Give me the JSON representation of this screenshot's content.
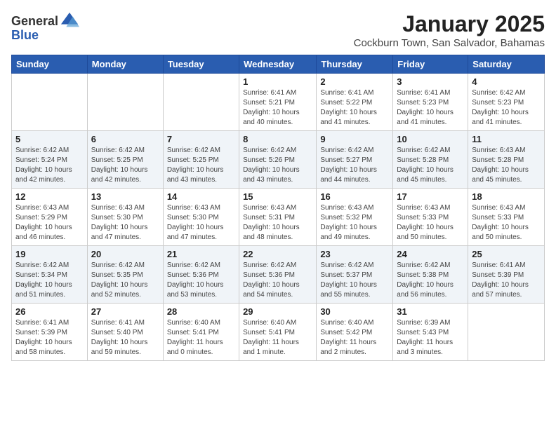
{
  "logo": {
    "general": "General",
    "blue": "Blue"
  },
  "title": "January 2025",
  "subtitle": "Cockburn Town, San Salvador, Bahamas",
  "days_of_week": [
    "Sunday",
    "Monday",
    "Tuesday",
    "Wednesday",
    "Thursday",
    "Friday",
    "Saturday"
  ],
  "weeks": [
    [
      {
        "day": "",
        "info": ""
      },
      {
        "day": "",
        "info": ""
      },
      {
        "day": "",
        "info": ""
      },
      {
        "day": "1",
        "info": "Sunrise: 6:41 AM\nSunset: 5:21 PM\nDaylight: 10 hours\nand 40 minutes."
      },
      {
        "day": "2",
        "info": "Sunrise: 6:41 AM\nSunset: 5:22 PM\nDaylight: 10 hours\nand 41 minutes."
      },
      {
        "day": "3",
        "info": "Sunrise: 6:41 AM\nSunset: 5:23 PM\nDaylight: 10 hours\nand 41 minutes."
      },
      {
        "day": "4",
        "info": "Sunrise: 6:42 AM\nSunset: 5:23 PM\nDaylight: 10 hours\nand 41 minutes."
      }
    ],
    [
      {
        "day": "5",
        "info": "Sunrise: 6:42 AM\nSunset: 5:24 PM\nDaylight: 10 hours\nand 42 minutes."
      },
      {
        "day": "6",
        "info": "Sunrise: 6:42 AM\nSunset: 5:25 PM\nDaylight: 10 hours\nand 42 minutes."
      },
      {
        "day": "7",
        "info": "Sunrise: 6:42 AM\nSunset: 5:25 PM\nDaylight: 10 hours\nand 43 minutes."
      },
      {
        "day": "8",
        "info": "Sunrise: 6:42 AM\nSunset: 5:26 PM\nDaylight: 10 hours\nand 43 minutes."
      },
      {
        "day": "9",
        "info": "Sunrise: 6:42 AM\nSunset: 5:27 PM\nDaylight: 10 hours\nand 44 minutes."
      },
      {
        "day": "10",
        "info": "Sunrise: 6:42 AM\nSunset: 5:28 PM\nDaylight: 10 hours\nand 45 minutes."
      },
      {
        "day": "11",
        "info": "Sunrise: 6:43 AM\nSunset: 5:28 PM\nDaylight: 10 hours\nand 45 minutes."
      }
    ],
    [
      {
        "day": "12",
        "info": "Sunrise: 6:43 AM\nSunset: 5:29 PM\nDaylight: 10 hours\nand 46 minutes."
      },
      {
        "day": "13",
        "info": "Sunrise: 6:43 AM\nSunset: 5:30 PM\nDaylight: 10 hours\nand 47 minutes."
      },
      {
        "day": "14",
        "info": "Sunrise: 6:43 AM\nSunset: 5:30 PM\nDaylight: 10 hours\nand 47 minutes."
      },
      {
        "day": "15",
        "info": "Sunrise: 6:43 AM\nSunset: 5:31 PM\nDaylight: 10 hours\nand 48 minutes."
      },
      {
        "day": "16",
        "info": "Sunrise: 6:43 AM\nSunset: 5:32 PM\nDaylight: 10 hours\nand 49 minutes."
      },
      {
        "day": "17",
        "info": "Sunrise: 6:43 AM\nSunset: 5:33 PM\nDaylight: 10 hours\nand 50 minutes."
      },
      {
        "day": "18",
        "info": "Sunrise: 6:43 AM\nSunset: 5:33 PM\nDaylight: 10 hours\nand 50 minutes."
      }
    ],
    [
      {
        "day": "19",
        "info": "Sunrise: 6:42 AM\nSunset: 5:34 PM\nDaylight: 10 hours\nand 51 minutes."
      },
      {
        "day": "20",
        "info": "Sunrise: 6:42 AM\nSunset: 5:35 PM\nDaylight: 10 hours\nand 52 minutes."
      },
      {
        "day": "21",
        "info": "Sunrise: 6:42 AM\nSunset: 5:36 PM\nDaylight: 10 hours\nand 53 minutes."
      },
      {
        "day": "22",
        "info": "Sunrise: 6:42 AM\nSunset: 5:36 PM\nDaylight: 10 hours\nand 54 minutes."
      },
      {
        "day": "23",
        "info": "Sunrise: 6:42 AM\nSunset: 5:37 PM\nDaylight: 10 hours\nand 55 minutes."
      },
      {
        "day": "24",
        "info": "Sunrise: 6:42 AM\nSunset: 5:38 PM\nDaylight: 10 hours\nand 56 minutes."
      },
      {
        "day": "25",
        "info": "Sunrise: 6:41 AM\nSunset: 5:39 PM\nDaylight: 10 hours\nand 57 minutes."
      }
    ],
    [
      {
        "day": "26",
        "info": "Sunrise: 6:41 AM\nSunset: 5:39 PM\nDaylight: 10 hours\nand 58 minutes."
      },
      {
        "day": "27",
        "info": "Sunrise: 6:41 AM\nSunset: 5:40 PM\nDaylight: 10 hours\nand 59 minutes."
      },
      {
        "day": "28",
        "info": "Sunrise: 6:40 AM\nSunset: 5:41 PM\nDaylight: 11 hours\nand 0 minutes."
      },
      {
        "day": "29",
        "info": "Sunrise: 6:40 AM\nSunset: 5:41 PM\nDaylight: 11 hours\nand 1 minute."
      },
      {
        "day": "30",
        "info": "Sunrise: 6:40 AM\nSunset: 5:42 PM\nDaylight: 11 hours\nand 2 minutes."
      },
      {
        "day": "31",
        "info": "Sunrise: 6:39 AM\nSunset: 5:43 PM\nDaylight: 11 hours\nand 3 minutes."
      },
      {
        "day": "",
        "info": ""
      }
    ]
  ]
}
